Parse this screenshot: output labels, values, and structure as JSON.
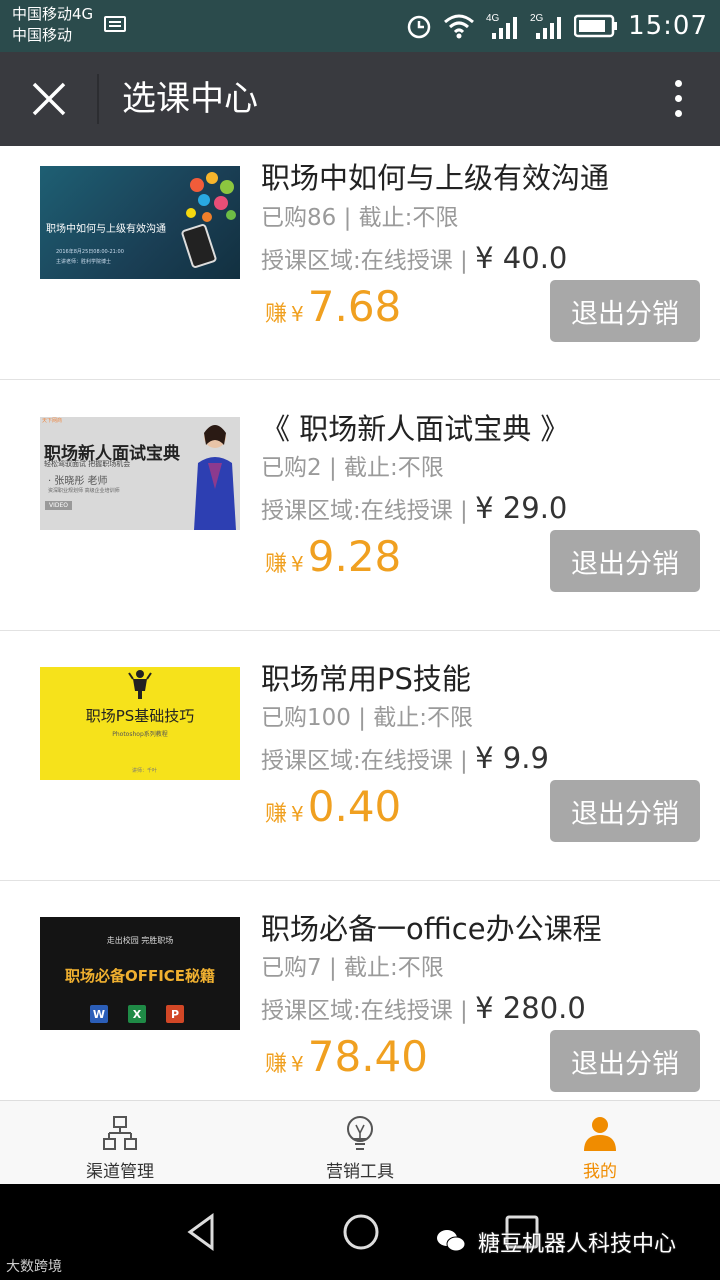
{
  "status_bar": {
    "carrier_line1": "中国移动4G",
    "carrier_line2": "中国移动",
    "time": "15:07",
    "net1": "4G",
    "net2": "2G"
  },
  "header": {
    "title": "选课中心"
  },
  "courses": [
    {
      "title": "职场中如何与上级有效沟通",
      "meta": "已购86 | 截止:不限",
      "region": "授课区域:在线授课 |",
      "price": "¥ 40.0",
      "earn_label": "赚",
      "earn_currency": "¥",
      "earn_amount": "7.68",
      "button": "退出分销",
      "thumb_text": "职场中如何与上级有效沟通",
      "thumb_sub1": "2016年8月25日08:00-21:00",
      "thumb_sub2": "主讲老师：胜利学院博士"
    },
    {
      "title": "《 职场新人面试宝典 》",
      "meta": "已购2 | 截止:不限",
      "region": "授课区域:在线授课 |",
      "price": "¥ 29.0",
      "earn_label": "赚",
      "earn_currency": "¥",
      "earn_amount": "9.28",
      "button": "退出分销",
      "thumb_logo": "天下网商",
      "thumb_big": "职场新人面试宝典",
      "thumb_small": "轻松驾驭面试 把握职场机会",
      "thumb_name": "· 张晓彤 老师",
      "thumb_desc": "资深职业规划师 高级企业培训师",
      "thumb_video": "VIDEO"
    },
    {
      "title": "职场常用PS技能",
      "meta": "已购100 | 截止:不限",
      "region": "授课区域:在线授课 |",
      "price": "¥ 9.9",
      "earn_label": "赚",
      "earn_currency": "¥",
      "earn_amount": "0.40",
      "button": "退出分销",
      "thumb_big": "职场PS基础技巧",
      "thumb_small": "Photoshop系列教程",
      "thumb_foot": "讲师：千叶"
    },
    {
      "title": "职场必备一office办公课程",
      "meta": "已购7 | 截止:不限",
      "region": "授课区域:在线授课 |",
      "price": "¥ 280.0",
      "earn_label": "赚",
      "earn_currency": "¥",
      "earn_amount": "78.40",
      "button": "退出分销",
      "thumb_small": "走出校园   完胜职场",
      "thumb_big": "职场必备OFFICE秘籍",
      "app_w": "W",
      "app_x": "X",
      "app_p": "P"
    }
  ],
  "tabs": [
    {
      "label": "渠道管理",
      "icon": "org-chart-icon"
    },
    {
      "label": "营销工具",
      "icon": "lightbulb-icon"
    },
    {
      "label": "我的",
      "icon": "user-icon"
    }
  ],
  "colors": {
    "accent": "#f08c00",
    "earn": "#f0a020",
    "header": "#393a3f",
    "status_bar": "#2b4b4c",
    "button": "#a8a8a8"
  },
  "watermark": {
    "text": "糖豆机器人科技中心",
    "corner": "大数跨境"
  }
}
